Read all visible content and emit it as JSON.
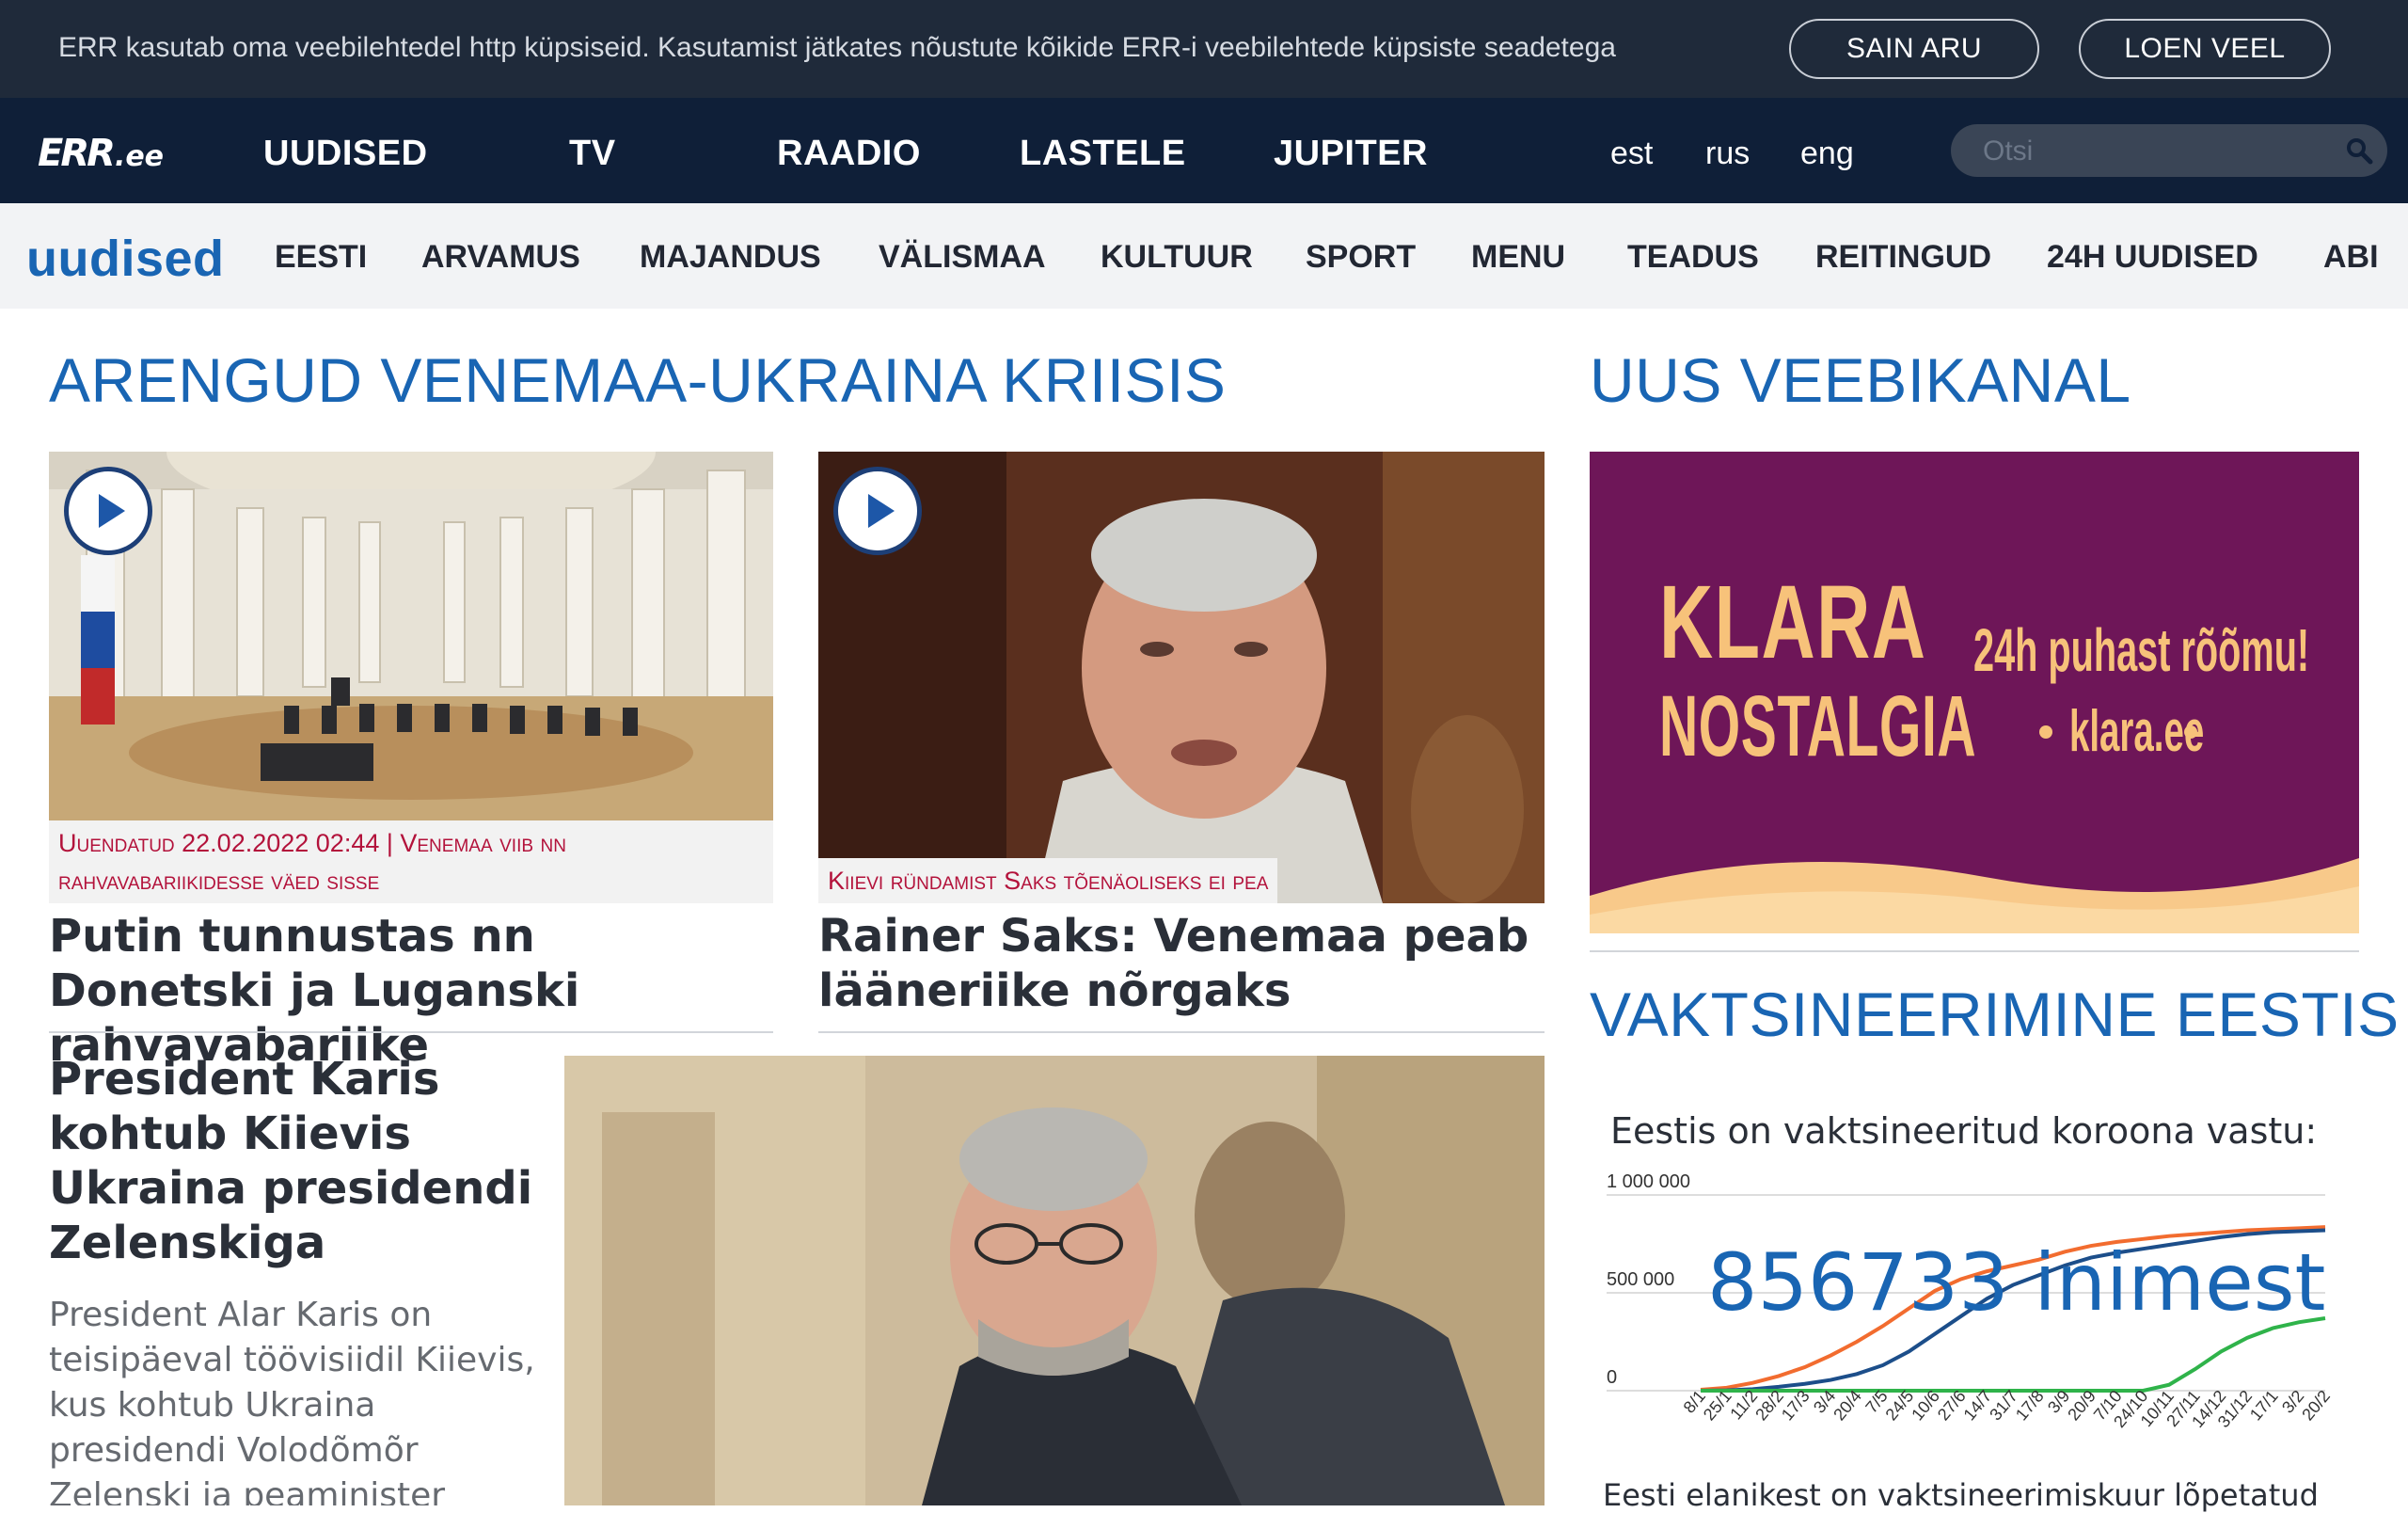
{
  "cookie": {
    "text": "ERR kasutab oma veebilehtedel http küpsiseid. Kasutamist jätkates nõustute kõikide ERR-i veebilehtede küpsiste seadetega",
    "accept_label": "SAIN ARU",
    "more_label": "LOEN VEEL"
  },
  "topnav": {
    "logo_main": "ERR",
    "logo_suffix": ".ee",
    "items": [
      "UUDISED",
      "TV",
      "RAADIO",
      "LASTELE",
      "JUPITER"
    ],
    "languages": [
      "est",
      "rus",
      "eng"
    ],
    "search_placeholder": "Otsi"
  },
  "secnav": {
    "brand": "uudised",
    "items": [
      "EESTI",
      "ARVAMUS",
      "MAJANDUS",
      "VÄLISMAA",
      "KULTUUR",
      "SPORT",
      "MENU",
      "TEADUS",
      "REITINGUD",
      "24H UUDISED",
      "ABI"
    ]
  },
  "main": {
    "section_title": "ARENGUD VENEMAA-UKRAINA KRIISIS",
    "cards": [
      {
        "tag": "Uuendatud 22.02.2022 02:44 | Venemaa viib nn rahvavabariikidesse väed sisse",
        "headline": "Putin tunnustas nn Donetski ja Luganski rahvavabariike"
      },
      {
        "tag": "Kiievi ründamist Saks tõenäoliseks ei pea",
        "headline": "Rainer Saks: Venemaa peab lääneriike nõrgaks"
      }
    ],
    "feature": {
      "headline": "President Karis kohtub Kiievis Ukraina presidendi Zelenskiga",
      "lead": "President Alar Karis on teisipäeval töövisiidil Kiievis, kus kohtub Ukraina presidendi Volodõmõr Zelenski ja peaminister Denõs"
    }
  },
  "side": {
    "channel_title": "UUS VEEBIKANAL",
    "klara": {
      "line1": "KLARA",
      "line2": "NOSTALGIA",
      "slogan": "24h puhast rõõmu!",
      "url": "klara.ee"
    },
    "vax_title": "VAKTSINEERIMINE EESTIS",
    "vax_caption": "Eestis on vaktsineeritud koroona vastu:",
    "vax_bottom": "Eesti elanikest on vaktsineerimiskuur lõpetatud",
    "colors": {
      "orange": "#f26c2f",
      "navy": "#1c4e8a",
      "green": "#2fb34a",
      "blue": "#1965b3"
    }
  },
  "chart_data": {
    "type": "line",
    "overlay_value": "856733",
    "overlay_unit": "inimest",
    "y_ticks": [
      "1 000 000",
      "500 000",
      "0"
    ],
    "ylim": [
      0,
      1000000
    ],
    "categories": [
      "8/1",
      "25/1",
      "11/2",
      "28/2",
      "17/3",
      "3/4",
      "20/4",
      "7/5",
      "24/5",
      "10/6",
      "27/6",
      "14/7",
      "31/7",
      "17/8",
      "3/9",
      "20/9",
      "7/10",
      "24/10",
      "10/11",
      "27/11",
      "14/12",
      "31/12",
      "17/1",
      "3/2",
      "20/2"
    ],
    "series": [
      {
        "color": "orange",
        "values": [
          5000,
          15000,
          40000,
          75000,
          120000,
          180000,
          250000,
          330000,
          420000,
          510000,
          570000,
          610000,
          640000,
          670000,
          710000,
          740000,
          760000,
          775000,
          790000,
          800000,
          810000,
          820000,
          825000,
          830000,
          836000
        ]
      },
      {
        "color": "navy",
        "values": [
          0,
          2000,
          8000,
          20000,
          35000,
          55000,
          85000,
          130000,
          200000,
          290000,
          380000,
          470000,
          540000,
          590000,
          640000,
          680000,
          705000,
          725000,
          745000,
          765000,
          785000,
          800000,
          810000,
          815000,
          820000
        ]
      },
      {
        "color": "green",
        "values": [
          0,
          0,
          0,
          0,
          0,
          0,
          0,
          0,
          0,
          0,
          0,
          0,
          0,
          0,
          0,
          0,
          0,
          0,
          30000,
          110000,
          200000,
          270000,
          320000,
          350000,
          370000
        ]
      }
    ]
  }
}
